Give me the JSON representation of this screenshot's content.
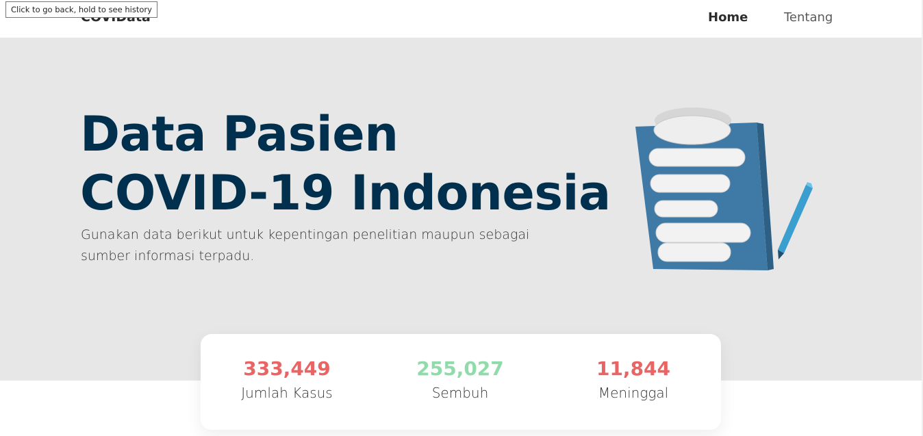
{
  "tooltip": "Click to go back, hold to see history",
  "nav": {
    "brand": "COVIData",
    "links": [
      {
        "label": "Home"
      },
      {
        "label": "Tentang"
      }
    ]
  },
  "hero": {
    "title_line1": "Data Pasien",
    "title_line2": "COVID-19 Indonesia",
    "subtitle": "Gunakan data berikut untuk kepentingan penelitian maupun sebagai sumber informasi terpadu.",
    "illustration_icon": "clipboard-with-pencil-illustration"
  },
  "stats": [
    {
      "value": "333,449",
      "label": "Jumlah Kasus",
      "color": "#e96464"
    },
    {
      "value": "255,027",
      "label": "Sembuh",
      "color": "#8fdcaa"
    },
    {
      "value": "11,844",
      "label": "Meninggal",
      "color": "#e96464"
    }
  ],
  "colors": {
    "hero_background": "#e7e7e7",
    "title_color": "#00304d",
    "clipboard_blue": "#3f7aa6",
    "pencil_blue": "#3a9fcf"
  }
}
